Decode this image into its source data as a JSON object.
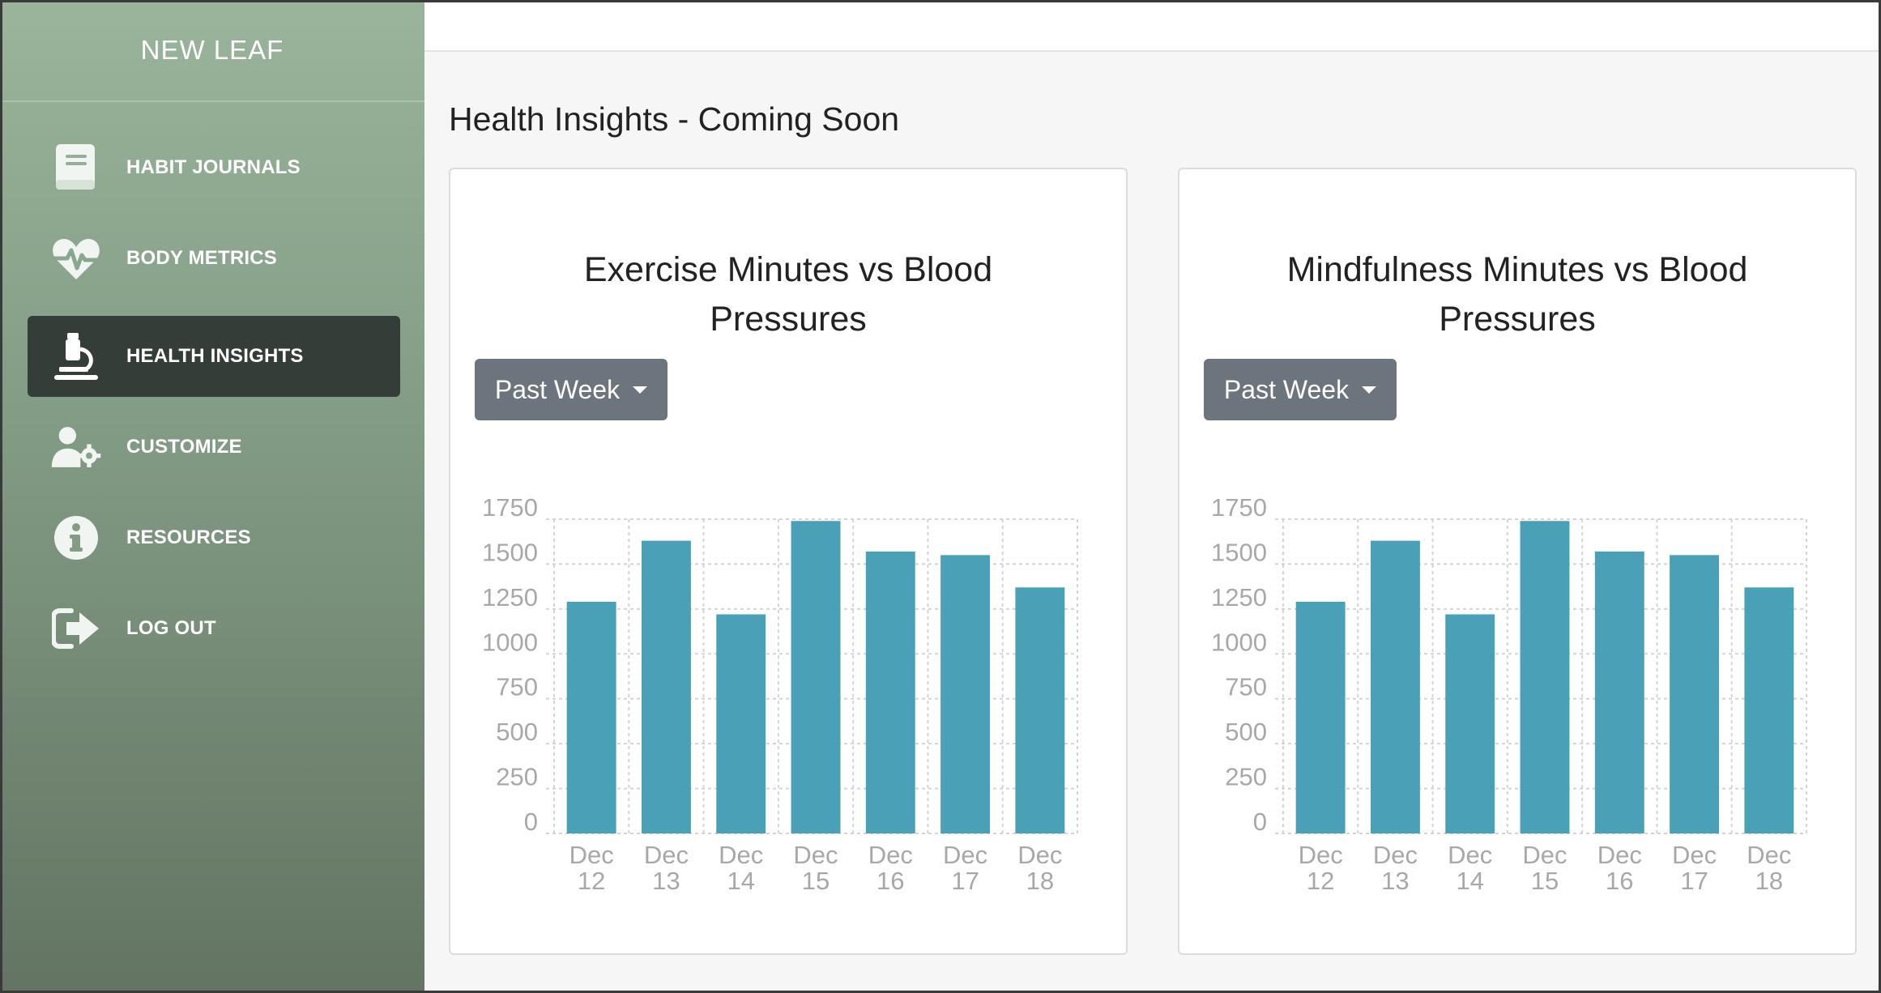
{
  "brand": "NEW LEAF",
  "nav": [
    {
      "label": "HABIT JOURNALS",
      "icon": "book-icon",
      "active": false
    },
    {
      "label": "BODY METRICS",
      "icon": "heartbeat-icon",
      "active": false
    },
    {
      "label": "HEALTH INSIGHTS",
      "icon": "microscope-icon",
      "active": true
    },
    {
      "label": "CUSTOMIZE",
      "icon": "user-cog-icon",
      "active": false
    },
    {
      "label": "RESOURCES",
      "icon": "info-circle-icon",
      "active": false
    },
    {
      "label": "LOG OUT",
      "icon": "sign-out-icon",
      "active": false
    }
  ],
  "page_title": "Health Insights - Coming Soon",
  "cards": [
    {
      "title_line1": "Exercise Minutes vs Blood",
      "title_line2": "Pressures",
      "filter": "Past Week"
    },
    {
      "title_line1": "Mindfulness Minutes vs Blood",
      "title_line2": "Pressures",
      "filter": "Past Week"
    }
  ],
  "colors": {
    "bar": "#4aa1b7",
    "active_nav": "#343d38",
    "dropdown": "#6c757d"
  },
  "chart_data": [
    {
      "type": "bar",
      "categories": [
        [
          "Dec",
          "12"
        ],
        [
          "Dec",
          "13"
        ],
        [
          "Dec",
          "14"
        ],
        [
          "Dec",
          "15"
        ],
        [
          "Dec",
          "16"
        ],
        [
          "Dec",
          "17"
        ],
        [
          "Dec",
          "18"
        ]
      ],
      "values": [
        1290,
        1630,
        1220,
        1740,
        1570,
        1550,
        1370
      ],
      "yticks": [
        0,
        250,
        500,
        750,
        1000,
        1250,
        1500,
        1750
      ],
      "ylim": [
        0,
        1750
      ],
      "grid": true
    },
    {
      "type": "bar",
      "categories": [
        [
          "Dec",
          "12"
        ],
        [
          "Dec",
          "13"
        ],
        [
          "Dec",
          "14"
        ],
        [
          "Dec",
          "15"
        ],
        [
          "Dec",
          "16"
        ],
        [
          "Dec",
          "17"
        ],
        [
          "Dec",
          "18"
        ]
      ],
      "values": [
        1290,
        1630,
        1220,
        1740,
        1570,
        1550,
        1370
      ],
      "yticks": [
        0,
        250,
        500,
        750,
        1000,
        1250,
        1500,
        1750
      ],
      "ylim": [
        0,
        1750
      ],
      "grid": true
    }
  ]
}
